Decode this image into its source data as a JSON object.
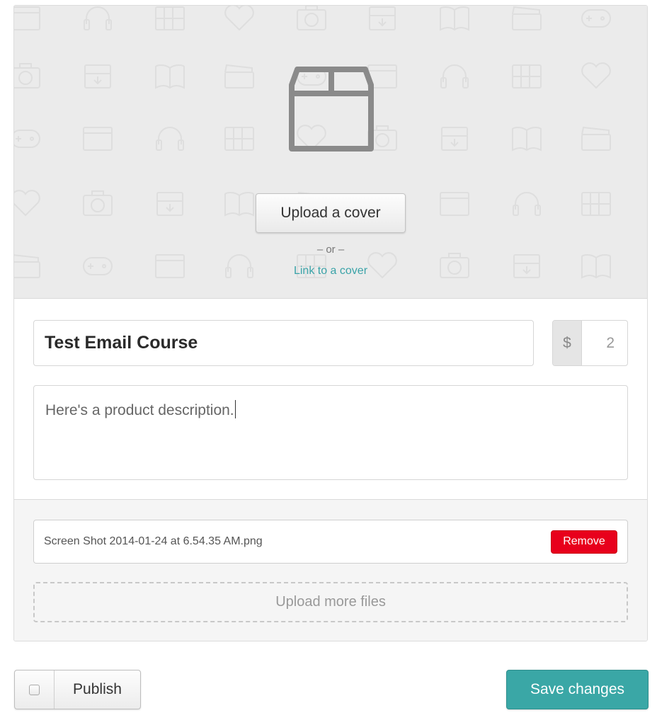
{
  "cover": {
    "upload_label": "Upload a cover",
    "or_text": "– or –",
    "link_label": "Link to a cover",
    "icon": "box-icon",
    "pattern_icons": [
      "gamepad-icon",
      "browser-window-icon",
      "headphones-icon",
      "calendar-icon",
      "heart-icon",
      "camera-icon",
      "download-box-icon",
      "book-icon",
      "clapperboard-icon"
    ]
  },
  "product": {
    "title": "Test Email Course",
    "currency": "$",
    "price": "2",
    "description": "Here's a product description."
  },
  "files": {
    "items": [
      {
        "name": "Screen Shot 2014-01-24 at 6.54.35 AM.png",
        "remove_label": "Remove"
      }
    ],
    "upload_more_label": "Upload more files"
  },
  "footer": {
    "publish_label": "Publish",
    "publish_checked": false,
    "save_label": "Save changes"
  },
  "colors": {
    "accent": "#3aa7a6",
    "link": "#3aa3a8",
    "danger": "#e8001c",
    "cover_bg": "#ebebeb"
  }
}
